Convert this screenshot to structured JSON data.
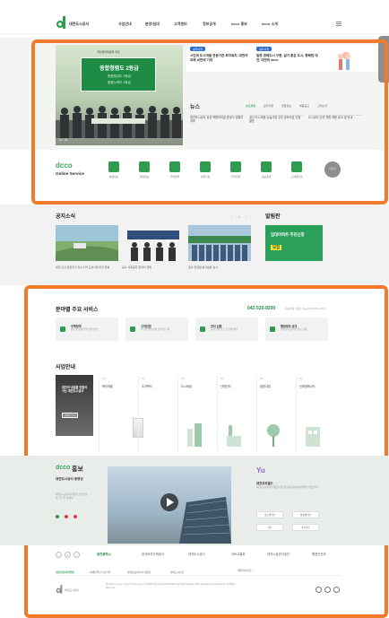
{
  "header": {
    "logo_text": "대전도시공사",
    "nav": [
      "사업안내",
      "분양/임대",
      "고객센터",
      "정보공개",
      "dcco 홍보",
      "dcco 소개"
    ]
  },
  "hero": {
    "card_title": "종합청렴도 2등급",
    "card_sub1": "청렴체감도 2등급",
    "card_sub2": "청렴노력도 1등급",
    "top_text": "국민권익위원회 주관",
    "controls": "01 / 05"
  },
  "banners": [
    {
      "pill": "공지사항",
      "text": "시민과 도시개발 전문기관 투자유치, 대전의 미래 비전에 기대"
    },
    {
      "pill": "공지사항",
      "text": "일류 경제도시 구현, 살기 좋은 도시, 행복한 대전, 대전의 dcco"
    }
  ],
  "news": {
    "title": "뉴스",
    "tabs": [
      "보도자료",
      "공지사항",
      "입찰정보",
      "채용공고",
      "고객소식"
    ],
    "cards": [
      "대전도시공사 유성 복합터미널 준공식 성황리 개최",
      "공사 도시재생 뉴딜사업 주민 공모사업 선정 발표",
      "도시공사 신규 직원 채용 공고 및 안내"
    ]
  },
  "online_service": {
    "brand": "dcco",
    "subtitle": "Online Service",
    "items": [
      "분양정보",
      "임대정보",
      "주택청약",
      "민원신청",
      "전자입찰",
      "정보공개",
      "고객의소리"
    ],
    "more": "더보기"
  },
  "gongmo": {
    "title": "공지소식",
    "captions": [
      "대전 도안 갑천지구 친수구역 조성사업 추진 현황",
      "공사 사회공헌 협약식 개최",
      "공사 임직원 봉사활동 실시"
    ]
  },
  "hongbo": {
    "title": "알림판",
    "banner_text": "임대아파트 주민신청",
    "banner_highlight": "모집"
  },
  "key_services": {
    "title": "분야별 주요 서비스",
    "phone": "042-530-9200",
    "phone_desc": "대표전화 / 상담 가능시간 09:00~18:00",
    "cards": [
      {
        "name": "주택청약",
        "desc": "분양 및 임대 주택 청약 안내"
      },
      {
        "name": "고객민원",
        "desc": "온라인 민원 신청 및 처리 조회"
      },
      {
        "name": "전자 입찰",
        "desc": "공사 입찰 공고 및 결과 확인"
      },
      {
        "name": "행정정보 공개",
        "desc": "경영공시 및 사전 정보 공개"
      }
    ]
  },
  "business_guide": {
    "title": "사업안내",
    "main_text": "대전의 내일을 만들어가는 대전도시공사",
    "main_btn": "자세히 보기",
    "columns": [
      {
        "num": "01",
        "name": "택지개발"
      },
      {
        "num": "02",
        "name": "주거복지"
      },
      {
        "num": "03",
        "name": "도시재생"
      },
      {
        "num": "04",
        "name": "산업단지"
      },
      {
        "num": "05",
        "name": "환경사업"
      },
      {
        "num": "06",
        "name": "신재생에너지"
      }
    ]
  },
  "pr": {
    "brand": "dcco",
    "brand_suffix": "홍보",
    "subtitle": "대전도시공사 동영상",
    "desc": "대전도시공사의 다양한 소식을 영상으로 만나보세요",
    "right_logo": "Yu",
    "right_title": "대전포토월드",
    "right_desc": "대전도시공사의 다양한 사진 자료를 한눈에 확인하실 수 있습니다",
    "buttons": [
      "포토갤러리",
      "영상갤러리",
      "사보",
      "홍보자료"
    ]
  },
  "partners": {
    "logos": [
      "대전광역시",
      "한국토지주택공사",
      "대전도시공사",
      "국토교통부",
      "대전시설관리공단",
      "행정안전부"
    ]
  },
  "footer": {
    "links": [
      "개인정보처리방침",
      "이메일무단수집거부",
      "영상정보처리기기운영",
      "찾아오시는길"
    ],
    "family_site": "패밀리사이트 +",
    "logo_text": "대전도시공사",
    "address": "대전광역시 유성구 유성대로 대전도시공사 (우)34000 대표전화 042-530-9200 Copyright Daejeon Urban Development Corporation. All Rights Reserved."
  }
}
